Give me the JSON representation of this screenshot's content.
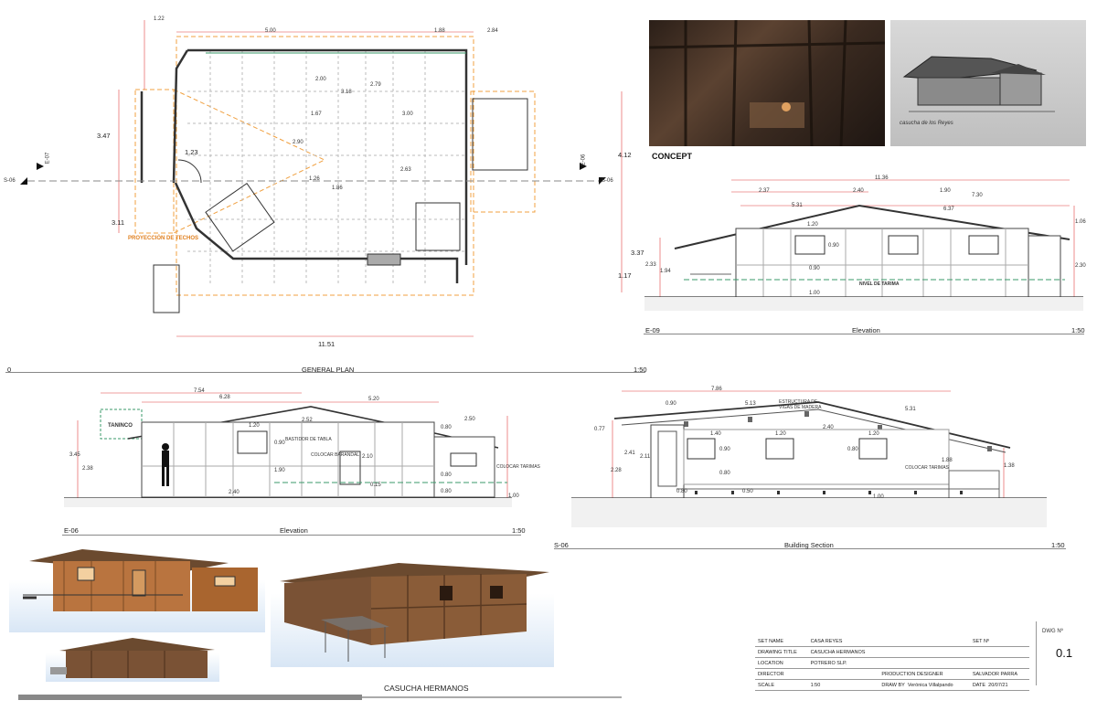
{
  "plan": {
    "view_label": "GENERAL PLAN",
    "view_code": "0",
    "scale": "1:50",
    "roof_projection": "PROYECCIÓN DE TECHOS",
    "section_left": "S-06",
    "section_right": "S-06",
    "elev_left": "E-07",
    "elev_right": "E-06",
    "dims": {
      "d1": "1.22",
      "d2": "5.00",
      "d3": "1.88",
      "d4": "2.84",
      "d5": "3.47",
      "d6": "1.23",
      "d7": "3.11",
      "d8": "4.12",
      "d9": "3.37",
      "d10": "1.17",
      "d11": "11.51",
      "d12": "2.00",
      "d13": "3.18",
      "d14": "2.79",
      "d15": "1.67",
      "d16": "2.90",
      "d17": "3.00",
      "d18": "2.63",
      "d19": "1.26",
      "d20": "1.86"
    }
  },
  "concept": {
    "label": "CONCEPT",
    "sketch_note": "casucha de los Reyes"
  },
  "elev_e09": {
    "code": "E-09",
    "label": "Elevation",
    "scale": "1:50",
    "dims": {
      "a": "11.36",
      "b": "2.37",
      "c": "2.40",
      "d": "1.90",
      "e": "7.30",
      "f": "5.31",
      "g": "6.37",
      "h": "1.20",
      "i": "0.90",
      "j": "0.90",
      "k": "1.00",
      "l": "2.33",
      "m": "1.94",
      "n": "1.06",
      "o": "2.30"
    },
    "level": "NIVEL DE TARIMA"
  },
  "elev_e06": {
    "code": "E-06",
    "label": "Elevation",
    "scale": "1:50",
    "tank": "TANINCO",
    "notes": [
      "BASTIDOR DE TABLA",
      "COLOCAR BARANDAL",
      "COLOCAR TARIMAS"
    ],
    "dims": {
      "a": "7.54",
      "b": "6.28",
      "c": "5.20",
      "d": "2.52",
      "e": "1.20",
      "f": "0.90",
      "g": "1.90",
      "h": "2.10",
      "i": "0.15",
      "j": "2.50",
      "k": "0.80",
      "l": "0.80",
      "m": "3.45",
      "n": "2.38",
      "o": "2.40",
      "p": "1.00",
      "q": "0.80"
    }
  },
  "section_s06": {
    "code": "S-06",
    "label": "Building Section",
    "scale": "1:50",
    "notes": [
      "ESTRUCTURA DE VIGAS DE MADERA",
      "COLOCAR TARIMAS"
    ],
    "dims": {
      "a": "7.86",
      "b": "0.90",
      "c": "5.13",
      "d": "0.77",
      "e": "2.41",
      "f": "2.11",
      "g": "2.28",
      "h": "1.40",
      "i": "1.20",
      "j": "2.40",
      "k": "1.20",
      "l": "0.90",
      "m": "0.80",
      "n": "0.80",
      "o": "1.88",
      "p": "1.38",
      "q": "0.80",
      "r": "0.50",
      "s": "1.00",
      "t": "5.31"
    }
  },
  "renders": {
    "caption": "CASUCHA HERMANOS"
  },
  "title_block": {
    "dwg_label": "DWG Nº",
    "dwg_no": "0.1",
    "set_name_label": "SET NAME",
    "set_name": "CASA REYES",
    "set_no_label": "SET Nº",
    "drawing_title_label": "DRAWING TITLE",
    "drawing_title": "CASUCHA HERMANOS",
    "location_label": "LOCATION",
    "location": "POTRERO SLP.",
    "director_label": "DIRECTOR",
    "pd_label": "PRODUCTION DESIGNER",
    "pd": "SALVADOR PARRA",
    "scale_label": "SCALE",
    "scale": "1:50",
    "drawn_label": "DRAW BY",
    "drawn": "Verónica Villalpando",
    "date_label": "DATE",
    "date": "20/07/21"
  },
  "colors": {
    "orange": "#f0a040",
    "red": "#e04040",
    "green": "#3a9a6a",
    "line": "#333333",
    "wood": "#b9743f"
  }
}
